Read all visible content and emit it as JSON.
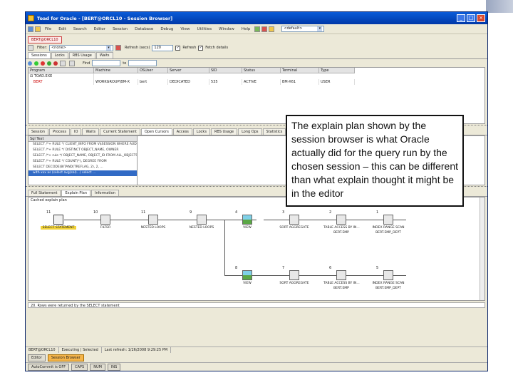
{
  "window": {
    "title": "Toad for Oracle - [BERT@ORCL10 - Session Browser]"
  },
  "menu": [
    "File",
    "Edit",
    "Search",
    "Edit",
    "Editor",
    "Session",
    "Database",
    "Debug",
    "View",
    "Utilities",
    "Window",
    "Help"
  ],
  "toolbar": {
    "schema_combo": "<default>"
  },
  "doc_tab": "BERT@ORCL10",
  "filter": {
    "filter_label": "Filter:",
    "filter_value": "<none>",
    "refresh_label": "Refresh (secs)",
    "refresh_value": "120",
    "refresh_chk": "Refresh",
    "fetch_chk": "Fetch details"
  },
  "top_tabs": [
    "Sessions",
    "Locks",
    "RBS Usage",
    "Waits"
  ],
  "icon_bar": {
    "find_label": "Find",
    "to_label": "to"
  },
  "session_grid": {
    "headers": [
      "Program",
      "Machine",
      "OSUser",
      "Server",
      "SID",
      "Status",
      "Terminal",
      "Type"
    ],
    "rows": [
      {
        "cells": [
          "TOAD.EXE",
          "",
          "",
          "",
          "",
          "",
          "",
          ""
        ]
      },
      {
        "cells": [
          "BERT",
          "WORKGROUP\\BM-X",
          "bert",
          "DEDICATED",
          "535",
          "ACTIVE",
          "BM-X61",
          "USER"
        ]
      }
    ]
  },
  "detail_tabs": [
    "Session",
    "Process",
    "IO",
    "Waits",
    "Current Statement",
    "Open Cursors",
    "Access",
    "Locks",
    "RBS Usage",
    "Long Ops",
    "Statistics"
  ],
  "sql_list": {
    "header": "Sql Text",
    "rows": [
      "SELECT /*+ RULE */ CLIENT_INFO FROM V$SESSION WHERE AUDSID...",
      "SELECT /*+ RULE */ DISTINCT OBJECT_NAME, OWNER",
      "SELECT /*+ rule */ OBJECT_NAME, OBJECT_ID FROM ALL_OBJECTS",
      "SELECT /*+ RULE */ COUNT(*), DEGREE FROM",
      "SELECT DECODE(BITAND(TREFLAG, 2), 2, ...",
      "with xxx as (select avg(sal)...) select ..."
    ]
  },
  "plan_tabs": [
    "Full Statement",
    "Explain Plan",
    "Information"
  ],
  "plan": {
    "label": "Cached explain plan",
    "nodes": [
      {
        "num": "11",
        "cap": "SELECT STATEMENT"
      },
      {
        "num": "10",
        "cap": "FILTER"
      },
      {
        "num": "11",
        "cap": "NESTED LOOPS"
      },
      {
        "num": "9",
        "cap": "NESTED LOOPS"
      },
      {
        "num": "4",
        "cap": "VIEW"
      },
      {
        "num": "3",
        "cap": "SORT AGGREGATE"
      },
      {
        "num": "2",
        "cap": "TABLE ACCESS BY IN..."
      },
      {
        "num": "1",
        "cap": "INDEX RANGE SCAN"
      },
      {
        "num": "8",
        "cap": "VIEW"
      },
      {
        "num": "7",
        "cap": "SORT AGGREGATE"
      },
      {
        "num": "6",
        "cap": "TABLE ACCESS BY IN..."
      },
      {
        "num": "5",
        "cap": "INDEX RANGE SCAN"
      }
    ],
    "sub_captions": [
      "BERT.EMP",
      "BERT.EMP_DEPT",
      "BERT.EMP",
      "BERT.EMP_DEPT"
    ],
    "status_line": "20. Rows were returned by the SELECT statement"
  },
  "statusbar": [
    "BERT@ORCL10",
    "Executing | Selected",
    "Last refresh: 1/26/2008 9:29:25 PM"
  ],
  "taskbar": {
    "editor": "Editor",
    "session_browser": "Session Browser"
  },
  "bottom": {
    "autocommit": "AutoCommit is OFF",
    "caps": "CAPS",
    "num": "NUM",
    "ins": "INS"
  },
  "callout": "The explain plan shown by the session browser is what Oracle actually did for the query run by the chosen session – this can be different than what explain thought it might be in the editor"
}
